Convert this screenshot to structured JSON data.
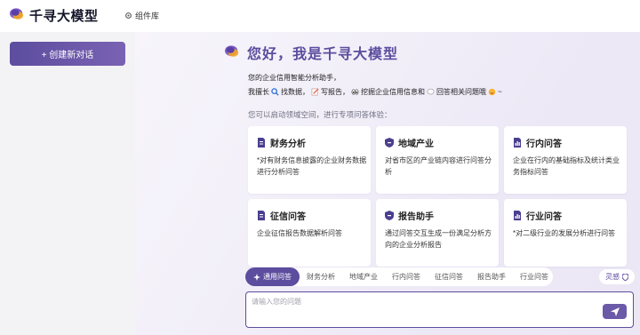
{
  "header": {
    "app_title": "千寻大模型",
    "components_label": "组件库"
  },
  "sidebar": {
    "new_chat_label": "+ 创建新对话"
  },
  "welcome": {
    "greeting": "您好，我是千寻大模型",
    "intro_line1": "您的企业信用智能分析助手，",
    "intro_line2": [
      {
        "text": "我擅长",
        "icon": ""
      },
      {
        "text": "找数据，",
        "icon": "magnifier-icon"
      },
      {
        "text": "写报告，",
        "icon": "memo-icon"
      },
      {
        "text": "挖掘企业信用信息和",
        "icon": "eyes-icon"
      },
      {
        "text": "回答相关问题哦",
        "icon": "bubble-icon"
      },
      {
        "text": "~",
        "icon": "smile-icon"
      }
    ],
    "subtitle": "您可以启动领域空间，进行专项问答体验："
  },
  "cards": [
    {
      "title": "财务分析",
      "desc": "*对有财务信息披露的企业财务数据进行分析问答"
    },
    {
      "title": "地域产业",
      "desc": "对省市区的产业链内容进行问答分析"
    },
    {
      "title": "行内问答",
      "desc": "企业在行内的基础指标及统计类业务指标问答"
    },
    {
      "title": "征信问答",
      "desc": "企业征信报告数据解析问答"
    },
    {
      "title": "报告助手",
      "desc": "通过问答交互生成一份满足分析方向的企业分析报告"
    },
    {
      "title": "行业问答",
      "desc": "*对二级行业的发展分析进行问答"
    }
  ],
  "tabs": [
    "通用问答",
    "财务分析",
    "地域产业",
    "行内问答",
    "征信问答",
    "报告助手",
    "行业问答"
  ],
  "active_tab": 0,
  "inspire_label": "灵感",
  "input": {
    "placeholder": "请输入您的问题",
    "value": ""
  },
  "colors": {
    "accent": "#5c4d9e",
    "card_icon": "#4a3f8f"
  }
}
